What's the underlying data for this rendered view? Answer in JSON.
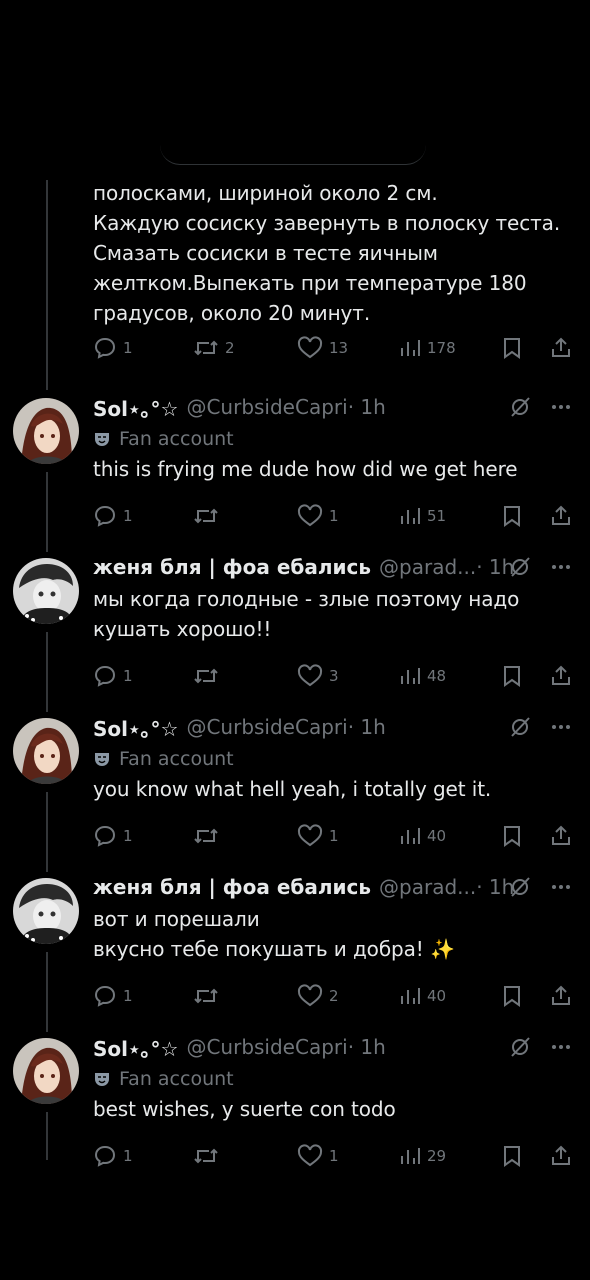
{
  "colors": {
    "background": "#000000",
    "text": "#e7e9ea",
    "muted": "#71767b",
    "line": "#333639"
  },
  "main_post": {
    "body": "полосками, шириной около 2 см.\nКаждую сосиску завернуть в полоску теста.\nСмазать сосиски в тесте яичным\nжелтком.Выпекать при температуре 180\nградусов, около 20 минут.",
    "replies": "1",
    "reposts": "2",
    "likes": "13",
    "views": "178"
  },
  "replies": [
    {
      "name": "Sol⋆｡°☆",
      "handle": "@CurbsideCapri",
      "time": "· 1h",
      "label": "Fan account",
      "avatar": "sol",
      "text": "this is frying me dude how did we get here",
      "stats": {
        "replies": "1",
        "reposts": "",
        "likes": "1",
        "views": "51"
      }
    },
    {
      "name": "женя бля | фоа ебались",
      "handle": "@parad...",
      "time": "· 1h",
      "label": "",
      "avatar": "zhenya",
      "text": "мы когда голодные - злые поэтому надо\nкушать хорошо!!",
      "stats": {
        "replies": "1",
        "reposts": "",
        "likes": "3",
        "views": "48"
      }
    },
    {
      "name": "Sol⋆｡°☆",
      "handle": "@CurbsideCapri",
      "time": "· 1h",
      "label": "Fan account",
      "avatar": "sol",
      "text": "you know what hell yeah, i totally get it.",
      "stats": {
        "replies": "1",
        "reposts": "",
        "likes": "1",
        "views": "40"
      }
    },
    {
      "name": "женя бля | фоа ебались",
      "handle": "@parad...",
      "time": "· 1h",
      "label": "",
      "avatar": "zhenya",
      "text": "вот и порешали\nвкусно тебе покушать и добра! ✨",
      "stats": {
        "replies": "1",
        "reposts": "",
        "likes": "2",
        "views": "40"
      }
    },
    {
      "name": "Sol⋆｡°☆",
      "handle": "@CurbsideCapri",
      "time": "· 1h",
      "label": "Fan account",
      "avatar": "sol",
      "text": "best wishes, y suerte con todo",
      "stats": {
        "replies": "1",
        "reposts": "",
        "likes": "1",
        "views": "29"
      }
    }
  ]
}
